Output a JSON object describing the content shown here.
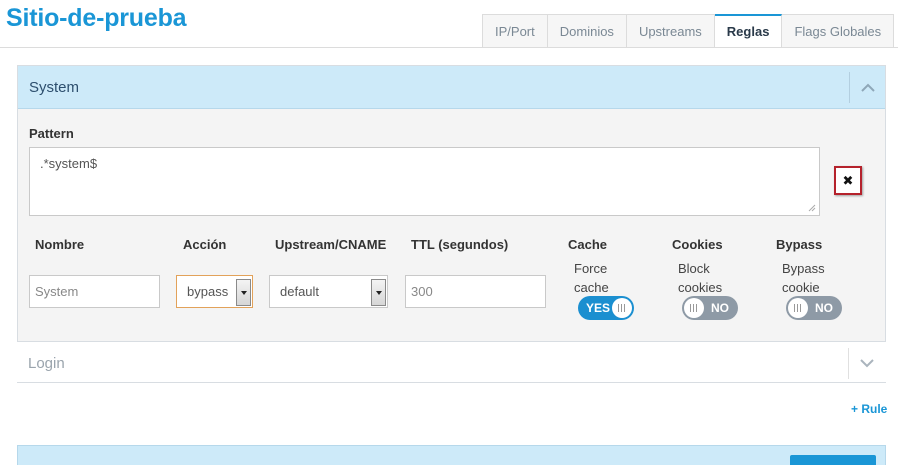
{
  "site": {
    "title": "Sitio-de-prueba"
  },
  "tabs": [
    {
      "label": "IP/Port",
      "active": false
    },
    {
      "label": "Dominios",
      "active": false
    },
    {
      "label": "Upstreams",
      "active": false
    },
    {
      "label": "Reglas",
      "active": true
    },
    {
      "label": "Flags Globales",
      "active": false
    }
  ],
  "rule_panel": {
    "title": "System",
    "expanded": true,
    "pattern_label": "Pattern",
    "pattern_value": ".*system$",
    "delete_icon": "close-icon",
    "fields": {
      "nombre_label": "Nombre",
      "nombre_placeholder": "System",
      "accion_label": "Acción",
      "accion_value": "bypass",
      "upstream_label": "Upstream/CNAME",
      "upstream_value": "default",
      "ttl_label": "TTL (segundos)",
      "ttl_placeholder": "300",
      "cache_label": "Cache",
      "cache_sub_line1": "Force",
      "cache_sub_line2": "cache",
      "cache_toggle": "YES",
      "cookies_label": "Cookies",
      "cookies_sub_line1": "Block",
      "cookies_sub_line2": "cookies",
      "cookies_toggle": "NO",
      "bypass_label": "Bypass",
      "bypass_sub_line1": "Bypass",
      "bypass_sub_line2": "cookie",
      "bypass_toggle": "NO"
    }
  },
  "login_panel": {
    "title": "Login",
    "expanded": false
  },
  "add_rule_label": "+ Rule",
  "colors": {
    "accent": "#1a96d6",
    "header_bg": "#cdeaf9",
    "danger": "#b5222c",
    "toggle_off": "#8e9aa6"
  }
}
